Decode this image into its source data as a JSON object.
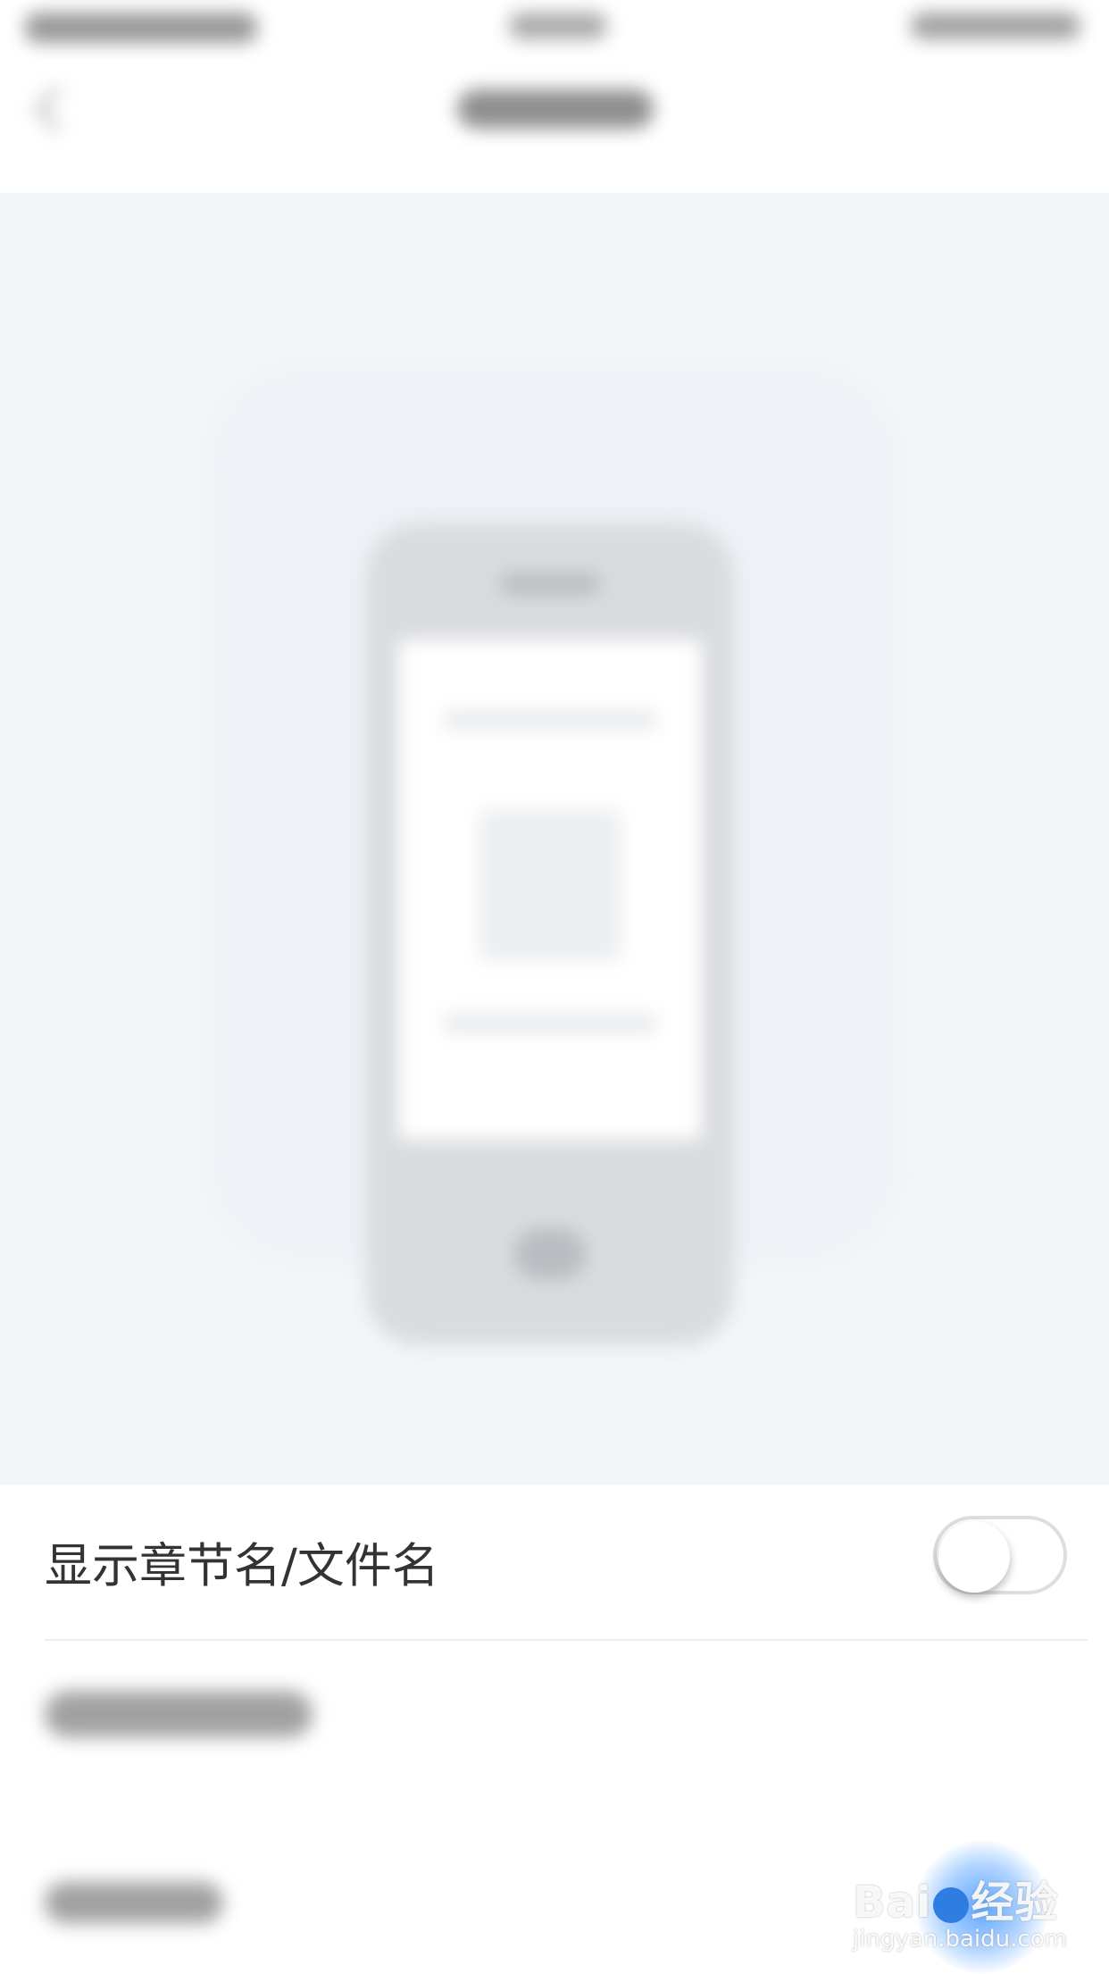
{
  "settings": {
    "show_chapter_name_label": "显示章节名/文件名",
    "show_chapter_name_enabled": false
  },
  "watermark": {
    "brand_left": "Bai",
    "brand_right": "经验",
    "url": "jingyan.baidu.com"
  }
}
